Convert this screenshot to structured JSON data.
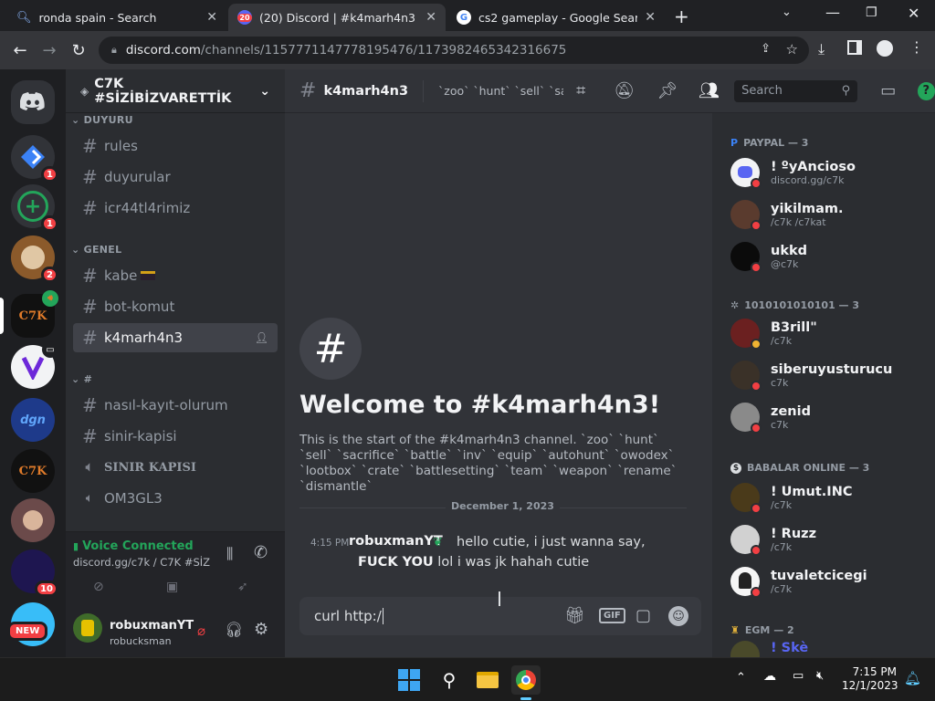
{
  "browser": {
    "tabs": [
      {
        "title": "ronda spain - Search",
        "active": false
      },
      {
        "title": "(20) Discord | #k4marh4n3 | C7K",
        "active": true,
        "badge": "20"
      },
      {
        "title": "cs2 gameplay - Google Search",
        "active": false
      }
    ],
    "url_host": "discord.com",
    "url_path": "/channels/1157771147778195476/1173982465342316675"
  },
  "servers": {
    "badges": [
      "1",
      "1",
      "2",
      "10"
    ],
    "item_labels": [
      "C7K",
      "C7K"
    ],
    "new_label": "NEW"
  },
  "sidebar": {
    "server_name": "C7K #SİZİBİZVARETTİK",
    "categories": [
      "DUYURU",
      "GENEL",
      "#"
    ],
    "channels": [
      "rules",
      "duyurular",
      "icr44tl4rimiz",
      "kabe",
      "bot-komut",
      "k4marh4n3",
      "nasıl-kayıt-olurum",
      "sinir-kapisi",
      "SINIR KAPISI",
      "OM3GL3"
    ],
    "voice_status": "Voice Connected",
    "voice_channel": "discord.gg/c7k / C7K #SİZİ...",
    "user_name": "robuxmanYT",
    "user_handle": "robucksman"
  },
  "chat": {
    "channel_name": "k4marh4n3",
    "topic": "`zoo` `hunt` `sell` `sacr...",
    "search_placeholder": "Search",
    "welcome_title": "Welcome to #k4marh4n3!",
    "welcome_text": "This is the start of the #k4marh4n3 channel. `zoo` `hunt` `sell` `sacrifice` `battle` `inv` `equip` `autohunt` `owodex` `lootbox` `crate` `battlesetting` `team` `weapon` `rename` `dismantle`",
    "date_divider": "December 1, 2023",
    "message": {
      "time": "4:15 PM",
      "author": "robuxmanYT",
      "line1": "hello cutie, i just wanna say,",
      "bold": "FUCK YOU",
      "line2": " lol i was jk hahah cutie"
    },
    "composer_value": "curl http:/"
  },
  "members": {
    "groups": [
      {
        "title": "PAYPAL — 3",
        "members": [
          {
            "name": "! ºyAncioso",
            "status": "discord.gg/c7k"
          },
          {
            "name": "yikilmam.",
            "status": "/c7k /c7kat"
          },
          {
            "name": "ukkd",
            "status": "@c7k"
          }
        ]
      },
      {
        "title": "1010101010101 — 3",
        "members": [
          {
            "name": "B3rill\"",
            "status": "/c7k"
          },
          {
            "name": "siberuyusturucu",
            "status": "c7k"
          },
          {
            "name": "zenid",
            "status": "c7k"
          }
        ]
      },
      {
        "title": "BABALAR ONLINE — 3",
        "members": [
          {
            "name": "! Umut.INC",
            "status": "/c7k"
          },
          {
            "name": "! Ruzz",
            "status": "/c7k"
          },
          {
            "name": "tuvaletcicegi",
            "status": "/c7k"
          }
        ]
      },
      {
        "title": "EGM — 2",
        "members": [
          {
            "name": "! Skè",
            "status": ""
          }
        ]
      }
    ]
  },
  "taskbar": {
    "time": "7:15 PM",
    "date": "12/1/2023"
  },
  "colors": {
    "blurple": "#5865f2",
    "green": "#23a55a",
    "red": "#f23f43"
  }
}
